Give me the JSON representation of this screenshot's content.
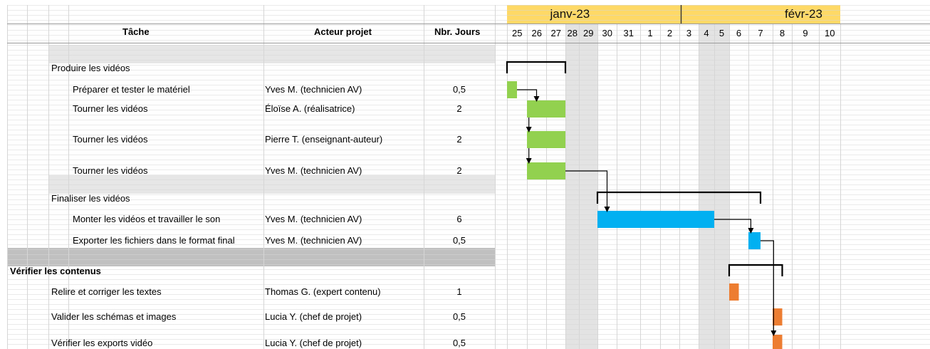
{
  "headers": {
    "task": "Tâche",
    "actor": "Acteur projet",
    "days": "Nbr. Jours"
  },
  "months": [
    {
      "label": "janv-23",
      "from": 0,
      "to": 7
    },
    {
      "label": "févr-23",
      "from": 7,
      "to": 17
    }
  ],
  "days": [
    "25",
    "26",
    "27",
    "28",
    "29",
    "30",
    "31",
    "1",
    "2",
    "3",
    "4",
    "5",
    "6",
    "7",
    "8",
    "9",
    "10"
  ],
  "weekend_day_indices": [
    3,
    4,
    10,
    11
  ],
  "colors": {
    "month_band": "#FFD966",
    "group_row": "#E6E6E6",
    "section_row": "#C0C0C0",
    "weekend": "#E3E3E3",
    "green": "#92D050",
    "blue": "#00B0F0",
    "orange": "#ED7D31",
    "grid": "#D6D6D6"
  },
  "rows": [
    {
      "type": "group",
      "task": "Produire les vidéos"
    },
    {
      "type": "task",
      "task": "Préparer et tester le matériel",
      "actor": "Yves M. (technicien AV)",
      "days": "0,5"
    },
    {
      "type": "task",
      "task": "Tourner les vidéos",
      "actor": "Éloïse A. (réalisatrice)",
      "days": "2"
    },
    {
      "type": "task",
      "task": "Tourner les vidéos",
      "actor": "Pierre T. (enseignant-auteur)",
      "days": "2"
    },
    {
      "type": "task",
      "task": "Tourner les vidéos",
      "actor": "Yves M. (technicien AV)",
      "days": "2"
    },
    {
      "type": "group",
      "task": "Finaliser les vidéos"
    },
    {
      "type": "task",
      "task": "Monter les vidéos et travailler le son",
      "actor": "Yves M. (technicien AV)",
      "days": "6"
    },
    {
      "type": "task",
      "task": "Exporter les fichiers dans le format final",
      "actor": "Yves M. (technicien AV)",
      "days": "0,5"
    },
    {
      "type": "section",
      "task": "Vérifier les contenus"
    },
    {
      "type": "task2",
      "task": "Relire et corriger les textes",
      "actor": "Thomas G. (expert contenu)",
      "days": "1"
    },
    {
      "type": "task2",
      "task": "Valider les schémas et images",
      "actor": "Lucia Y. (chef de projet)",
      "days": "0,5"
    },
    {
      "type": "task2",
      "task": "Vérifier les exports vidéo",
      "actor": "Lucia Y. (chef de projet)",
      "days": "0,5"
    }
  ],
  "bars": [
    {
      "row": 1,
      "start": 0,
      "duration": 0.5,
      "color": "green"
    },
    {
      "row": 2,
      "start": 1,
      "duration": 2,
      "color": "green"
    },
    {
      "row": 3,
      "start": 1,
      "duration": 2,
      "color": "green"
    },
    {
      "row": 4,
      "start": 1,
      "duration": 2,
      "color": "green"
    },
    {
      "row": 6,
      "start": 5,
      "duration": 6,
      "color": "blue"
    },
    {
      "row": 7,
      "start": 13,
      "duration": 0.5,
      "color": "blue"
    },
    {
      "row": 9,
      "start": 12,
      "duration": 0.5,
      "color": "orange"
    },
    {
      "row": 10,
      "start": 14,
      "duration": 0.5,
      "color": "orange"
    },
    {
      "row": 11,
      "start": 14,
      "duration": 0.5,
      "color": "orange"
    }
  ],
  "summaries": [
    {
      "row": 0,
      "start": 0,
      "end": 3
    },
    {
      "row": 5,
      "start": 5,
      "end": 13.5
    },
    {
      "row": 8,
      "start": 12,
      "end": 14.5
    }
  ]
}
